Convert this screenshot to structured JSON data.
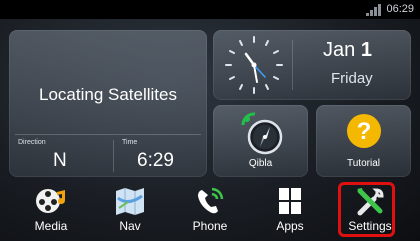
{
  "statusbar": {
    "time": "06:29"
  },
  "gps": {
    "title": "Locating Satellites",
    "direction_label": "Direction",
    "direction_value": "N",
    "time_label": "Time",
    "time_value": "6:29"
  },
  "clock_widget": {
    "month": "Jan",
    "day_number": "1",
    "weekday": "Friday"
  },
  "tiles": {
    "qibla_label": "Qibla",
    "tutorial_label": "Tutorial"
  },
  "dock": {
    "items": [
      {
        "label": "Media",
        "icon": "film-reel-icon"
      },
      {
        "label": "Nav",
        "icon": "map-icon"
      },
      {
        "label": "Phone",
        "icon": "phone-icon"
      },
      {
        "label": "Apps",
        "icon": "apps-grid-icon"
      },
      {
        "label": "Settings",
        "icon": "tools-icon"
      }
    ]
  },
  "colors": {
    "highlight": "#e01010",
    "tutorial_icon": "#f5b800",
    "qibla_accent": "#22c04a"
  }
}
